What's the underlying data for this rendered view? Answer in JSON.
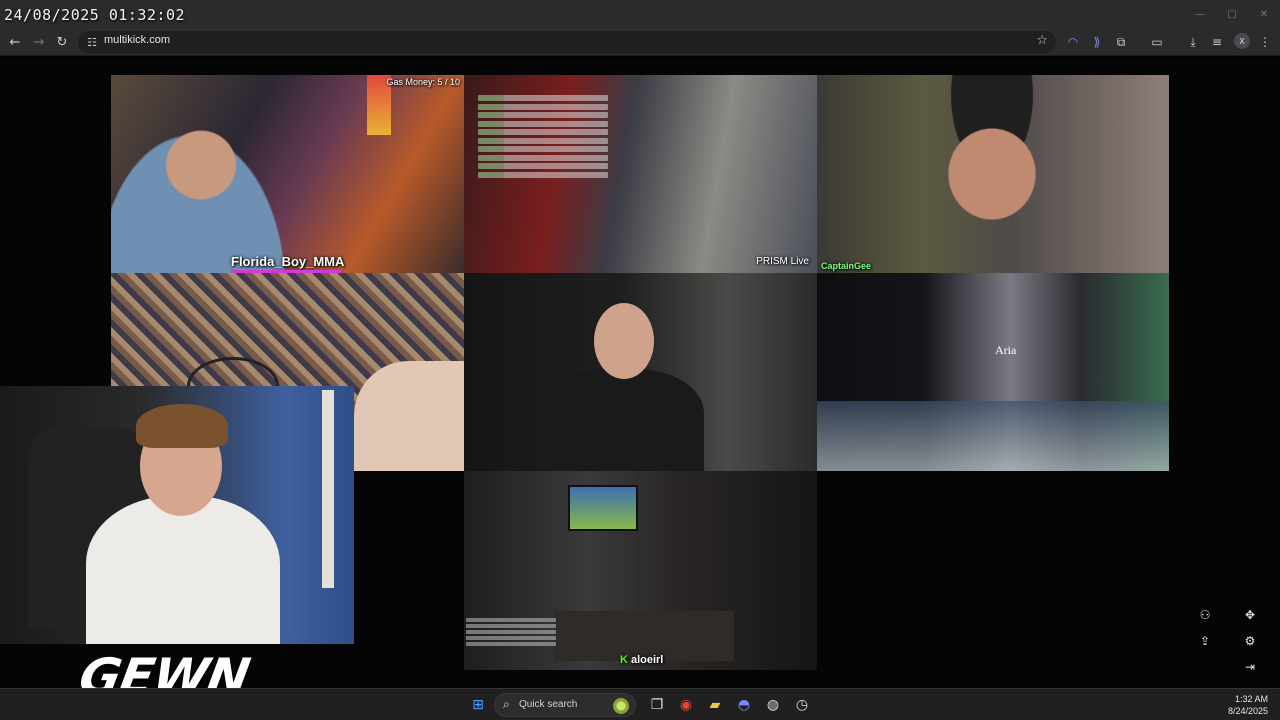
{
  "overlay": {
    "timestamp": "24/08/2025 01:32:02"
  },
  "browser": {
    "url": "multikick.com",
    "window_controls": [
      "—",
      "▢",
      "✕"
    ],
    "profile_initial": "X"
  },
  "streams": {
    "tile1": {
      "gas_money": "Gas Money:  5 / 10",
      "streamer": "Florida_Boy_MMA"
    },
    "tile2": {
      "watermark": "PRISM Live"
    },
    "tile3": {
      "streamer": "CaptainGee"
    },
    "tile6": {
      "sign": "Aria"
    },
    "tile7": {
      "streamer": "aloeirl",
      "platform_badge": "K"
    }
  },
  "streamer_logo": "GEWN",
  "taskbar": {
    "search_label": "Quick search",
    "time": "1:32 AM",
    "date": "8/24/2025"
  },
  "theme": {
    "accent_kick_green": "#53fc18",
    "tiktok_bar": "#d63ad6"
  }
}
